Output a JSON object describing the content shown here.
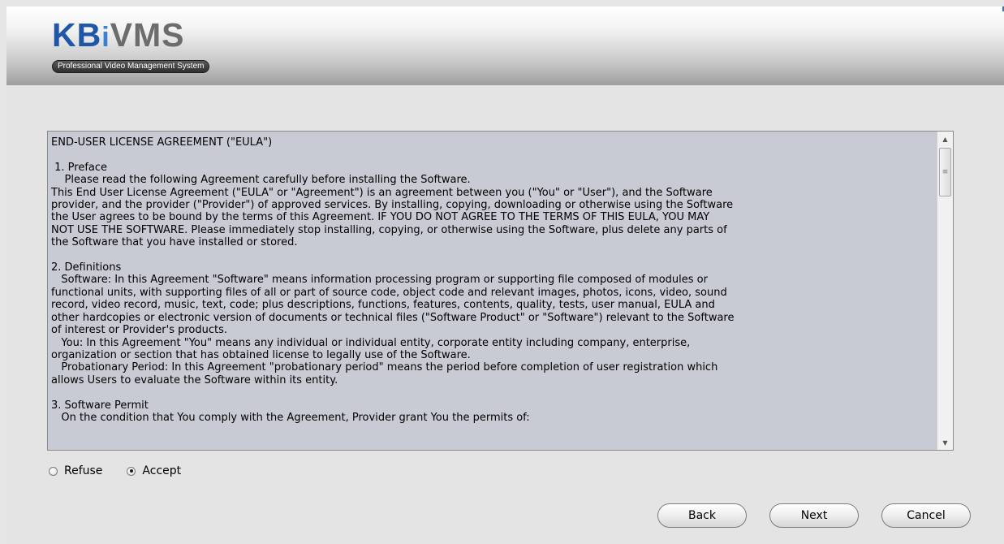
{
  "header": {
    "logo_kb": "KB",
    "logo_i": "i",
    "logo_vms": "VMS",
    "tagline": "Professional Video Management System"
  },
  "eula": {
    "text": "END-USER LICENSE AGREEMENT (\"EULA\")\n\n 1. Preface\n    Please read the following Agreement carefully before installing the Software.\nThis End User License Agreement (\"EULA\" or \"Agreement\") is an agreement between you (\"You\" or \"User\"), and the Software\nprovider, and the provider (\"Provider\") of approved services. By installing, copying, downloading or otherwise using the Software\nthe User agrees to be bound by the terms of this Agreement. IF YOU DO NOT AGREE TO THE TERMS OF THIS EULA, YOU MAY\nNOT USE THE SOFTWARE. Please immediately stop installing, copying, or otherwise using the Software, plus delete any parts of\nthe Software that you have installed or stored.\n\n2. Definitions\n   Software: In this Agreement \"Software\" means information processing program or supporting file composed of modules or\nfunctional units, with supporting files of all or part of source code, object code and relevant images, photos, icons, video, sound\nrecord, video record, music, text, code; plus descriptions, functions, features, contents, quality, tests, user manual, EULA and\nother hardcopies or electronic version of documents or technical files (\"Software Product\" or \"Software\") relevant to the Software\nof interest or Provider's products.\n   You: In this Agreement \"You\" means any individual or individual entity, corporate entity including company, enterprise,\norganization or section that has obtained license to legally use of the Software.\n   Probationary Period: In this Agreement \"probationary period\" means the period before completion of user registration which\nallows Users to evaluate the Software within its entity.\n\n3. Software Permit\n   On the condition that You comply with the Agreement, Provider grant You the permits of:"
  },
  "options": {
    "refuse_label": "Refuse",
    "accept_label": "Accept",
    "selected": "Accept"
  },
  "buttons": {
    "back": "Back",
    "next": "Next",
    "cancel": "Cancel"
  },
  "colors": {
    "brand_blue": "#1f56a8",
    "brand_gray": "#6c6c6c",
    "text_area_bg": "#c8cbd4"
  }
}
